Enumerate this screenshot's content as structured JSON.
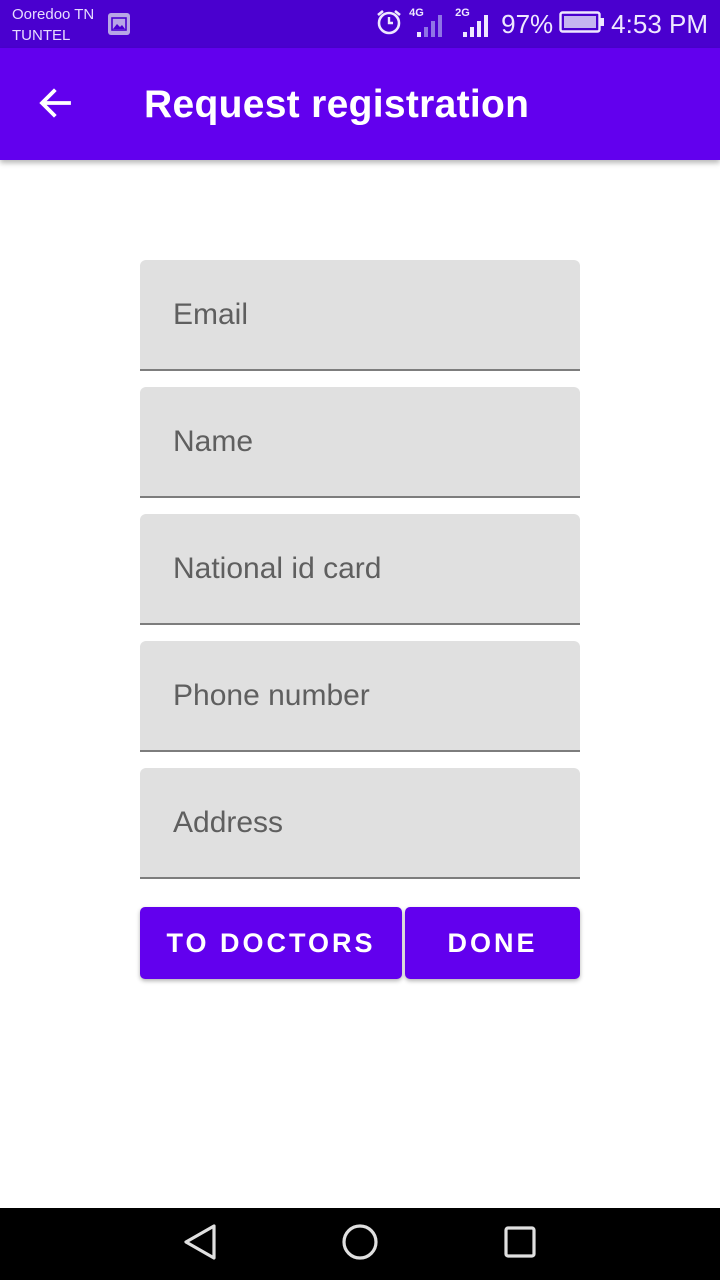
{
  "status_bar": {
    "carrier_line1": "Ooredoo TN",
    "carrier_line2": "TUNTEL",
    "network1": "4G",
    "network2": "2G",
    "battery": "97%",
    "time": "4:53 PM"
  },
  "app_bar": {
    "title": "Request registration",
    "back_icon": "arrow-left-icon",
    "color": "#6200ee"
  },
  "form": {
    "fields": [
      {
        "placeholder": "Email",
        "value": ""
      },
      {
        "placeholder": "Name",
        "value": ""
      },
      {
        "placeholder": "National id card",
        "value": ""
      },
      {
        "placeholder": "Phone number",
        "value": ""
      },
      {
        "placeholder": "Address",
        "value": ""
      }
    ],
    "to_doctors_label": "TO DOCTORS",
    "done_label": "DONE"
  },
  "nav_bar": {
    "icons": [
      "back-triangle-icon",
      "home-circle-icon",
      "recents-square-icon"
    ]
  },
  "colors": {
    "accent": "#6200ee",
    "status_bar": "#4a00cf",
    "field_bg": "#e0e0e0"
  }
}
